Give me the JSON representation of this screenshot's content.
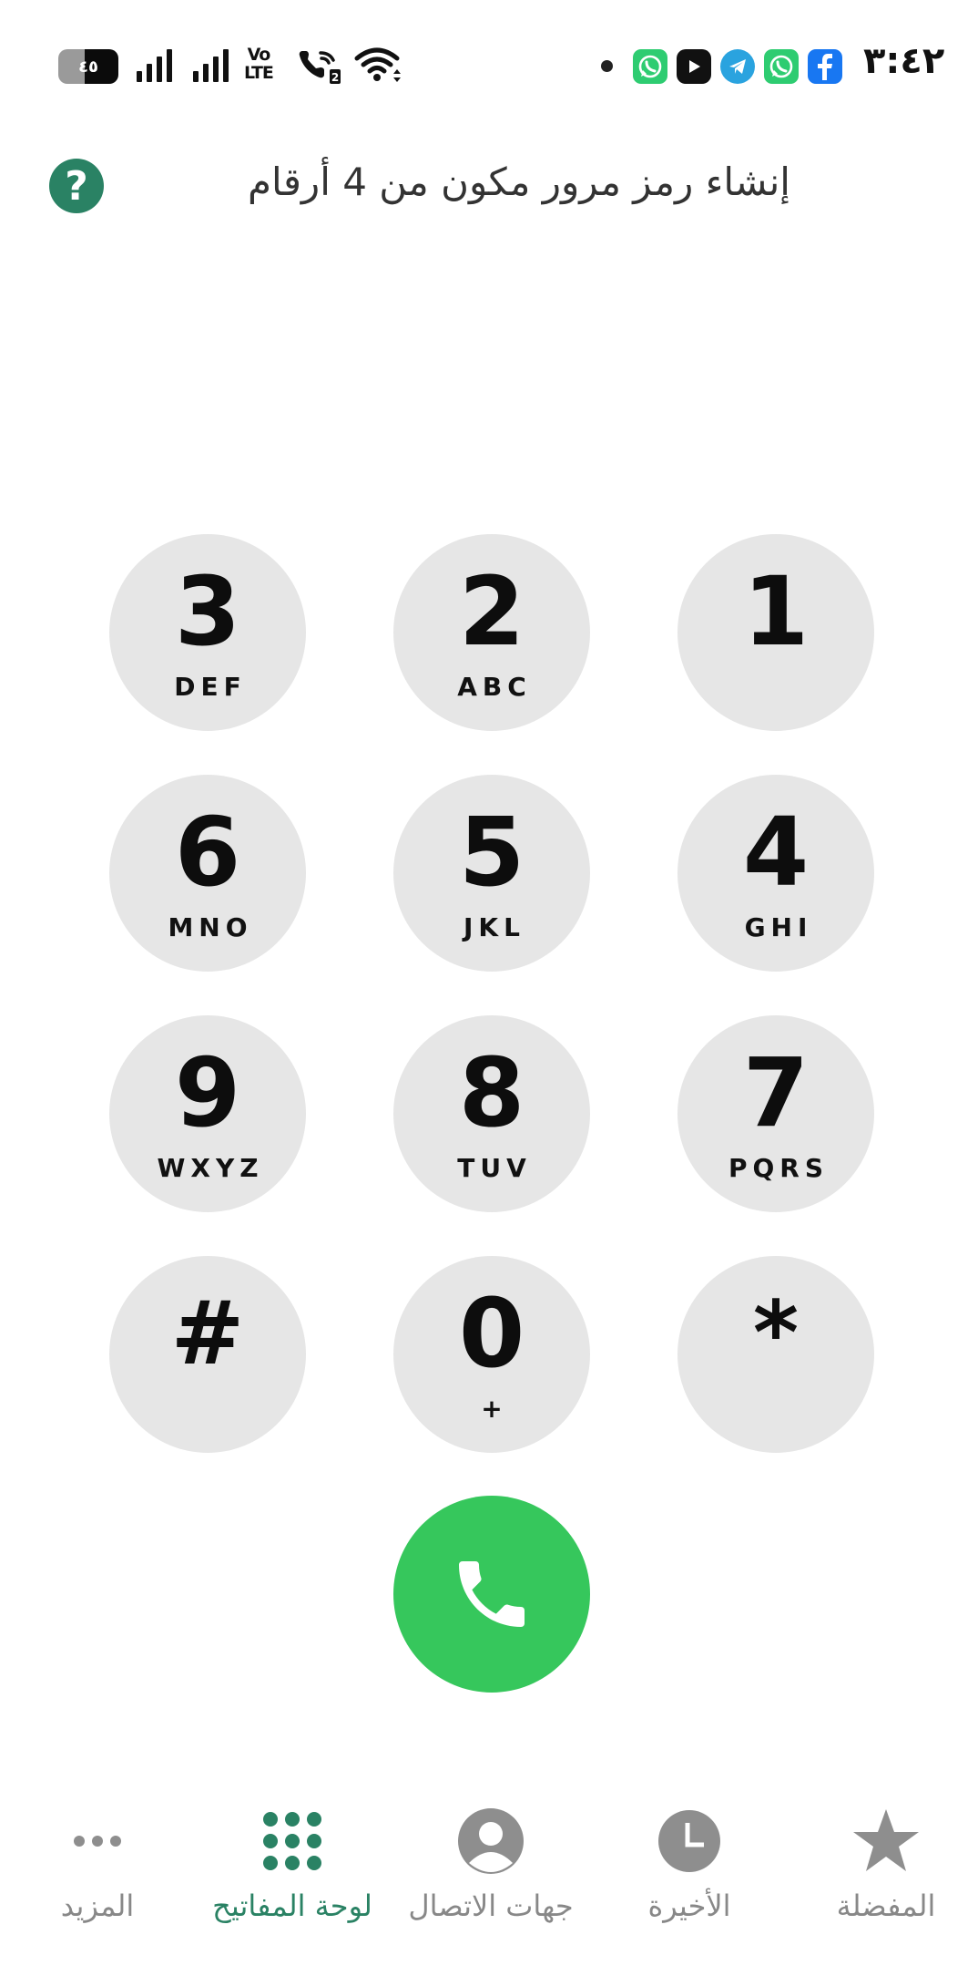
{
  "status_bar": {
    "battery_level": "٤٥",
    "volte_top": "Vo",
    "volte_bottom": "LTE",
    "time": "٣:٤٢"
  },
  "header": {
    "title": "إنشاء رمز مرور مكون من 4 أرقام",
    "help_symbol": "?"
  },
  "keypad": {
    "keys": [
      {
        "digit": "3",
        "letters": "DEF"
      },
      {
        "digit": "2",
        "letters": "ABC"
      },
      {
        "digit": "1",
        "letters": ""
      },
      {
        "digit": "6",
        "letters": "MNO"
      },
      {
        "digit": "5",
        "letters": "JKL"
      },
      {
        "digit": "4",
        "letters": "GHI"
      },
      {
        "digit": "9",
        "letters": "WXYZ"
      },
      {
        "digit": "8",
        "letters": "TUV"
      },
      {
        "digit": "7",
        "letters": "PQRS"
      },
      {
        "digit": "#",
        "letters": ""
      },
      {
        "digit": "0",
        "letters": "+"
      },
      {
        "digit": "*",
        "letters": ""
      }
    ]
  },
  "bottom_nav": {
    "active_color": "#2a8264",
    "inactive_color": "#888888",
    "items": [
      {
        "label": "المزيد",
        "icon": "more-dots-icon"
      },
      {
        "label": "لوحة المفاتيح",
        "icon": "dialpad-icon",
        "active": true
      },
      {
        "label": "جهات الاتصال",
        "icon": "person-icon"
      },
      {
        "label": "الأخيرة",
        "icon": "clock-icon"
      },
      {
        "label": "المفضلة",
        "icon": "star-icon"
      }
    ]
  },
  "colors": {
    "call_button": "#36c75c",
    "key_background": "#e6e6e6",
    "accent": "#2a8264"
  }
}
